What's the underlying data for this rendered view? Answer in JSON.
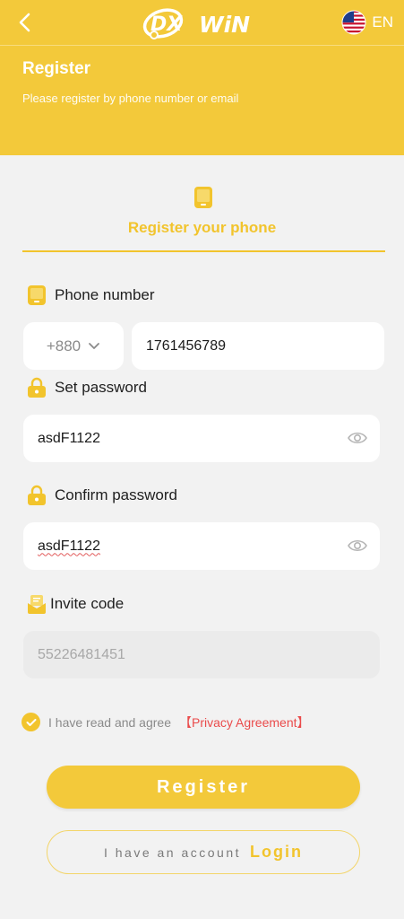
{
  "header": {
    "logo_text": "DX WIN",
    "language": "EN",
    "title": "Register",
    "subtitle": "Please register by phone number or email"
  },
  "tab": {
    "label": "Register your phone"
  },
  "form": {
    "phone_label": "Phone number",
    "country_code": "+880",
    "phone_value": "1761456789",
    "password_label": "Set password",
    "password_value": "asdF1122",
    "confirm_label": "Confirm password",
    "confirm_value": "asdF1122",
    "invite_label": "Invite code",
    "invite_value": "55226481451"
  },
  "agreement": {
    "checked": true,
    "text": "I have read and agree",
    "link": "【Privacy Agreement】"
  },
  "buttons": {
    "register": "Register",
    "have_account": "I have an account",
    "login": "Login"
  },
  "colors": {
    "brand_yellow": "#f3c93a",
    "link_red": "#ea4b4b"
  }
}
